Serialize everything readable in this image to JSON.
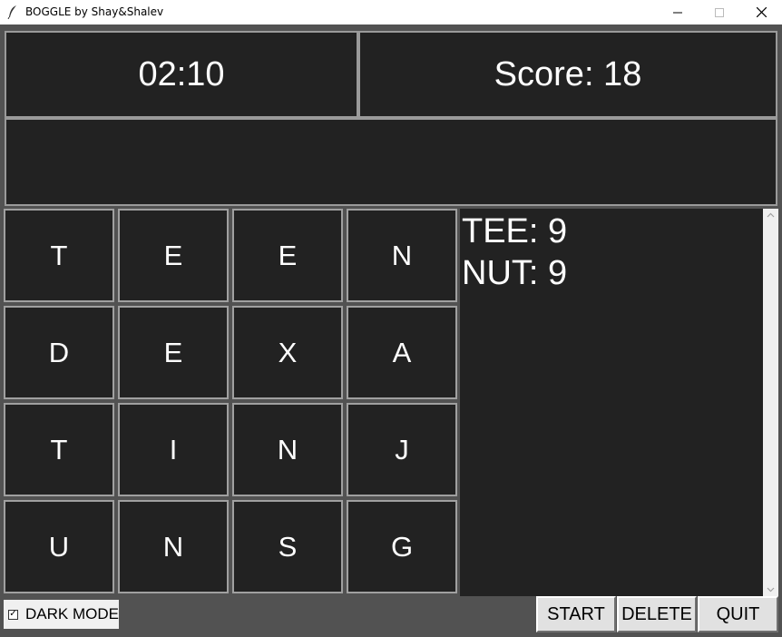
{
  "window": {
    "title": "BOGGLE by Shay&Shalev",
    "app_icon": "feather-icon",
    "controls": [
      "minimize-icon",
      "maximize-icon",
      "close-icon"
    ]
  },
  "game": {
    "timer": "02:10",
    "score_text": "Score: 18",
    "current_word": ""
  },
  "board": {
    "rows": [
      [
        "T",
        "E",
        "E",
        "N"
      ],
      [
        "D",
        "E",
        "X",
        "A"
      ],
      [
        "T",
        "I",
        "N",
        "J"
      ],
      [
        "U",
        "N",
        "S",
        "G"
      ]
    ]
  },
  "found_words": [
    "TEE: 9",
    "NUT: 9"
  ],
  "controls": {
    "dark_mode_label": "DARK MODE",
    "dark_mode_checked": true,
    "checkmark": "✓",
    "start_label": "START",
    "delete_label": "DELETE",
    "quit_label": "QUIT"
  },
  "colors": {
    "panel_bg": "#222222",
    "client_bg": "#525252",
    "text": "#ffffff",
    "button_bg": "#e1e1e1"
  }
}
